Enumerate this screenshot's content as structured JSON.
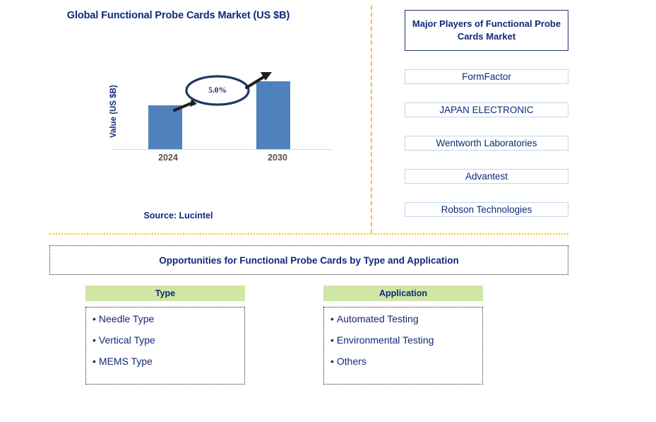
{
  "chart_panel": {
    "title": "Global Functional Probe Cards Market (US $B)",
    "y_axis_label": "Value (US $B)",
    "cagr_label": "5.0%",
    "source": "Source: Lucintel"
  },
  "chart_data": {
    "type": "bar",
    "title": "Global Functional Probe Cards Market (US $B)",
    "categories": [
      "2024",
      "2030"
    ],
    "values": [
      2.6,
      4.0
    ],
    "xlabel": "",
    "ylabel": "Value (US $B)",
    "ylim": [
      0,
      4.6
    ],
    "grid": false,
    "legend": "none",
    "bar_color": "#4F81BD",
    "annotations": [
      {
        "text": "5.0%",
        "shape": "ellipse-with-arrow",
        "from_category": "2024",
        "to_category": "2030",
        "meaning": "CAGR 2024-2030"
      }
    ]
  },
  "players_panel": {
    "header": "Major Players of Functional Probe Cards Market",
    "items": [
      {
        "label": "FormFactor"
      },
      {
        "label": "JAPAN ELECTRONIC"
      },
      {
        "label": "Wentworth Laboratories"
      },
      {
        "label": "Advantest"
      },
      {
        "label": "Robson Technologies"
      }
    ]
  },
  "opportunities": {
    "banner": "Opportunities for Functional Probe Cards by Type and Application",
    "columns": [
      {
        "header": "Type",
        "items": [
          "Needle Type",
          "Vertical Type",
          "MEMS Type"
        ]
      },
      {
        "header": "Application",
        "items": [
          "Automated Testing",
          "Environmental Testing",
          "Others"
        ]
      }
    ]
  },
  "bullet": "•",
  "colors": {
    "brand_navy": "#12287A",
    "bar_blue": "#4F81BD",
    "divider_gold": "#FFC000",
    "category_green": "#CFE6A4",
    "player_border": "#BDD7EE",
    "tick_gray": "#5B5248"
  }
}
